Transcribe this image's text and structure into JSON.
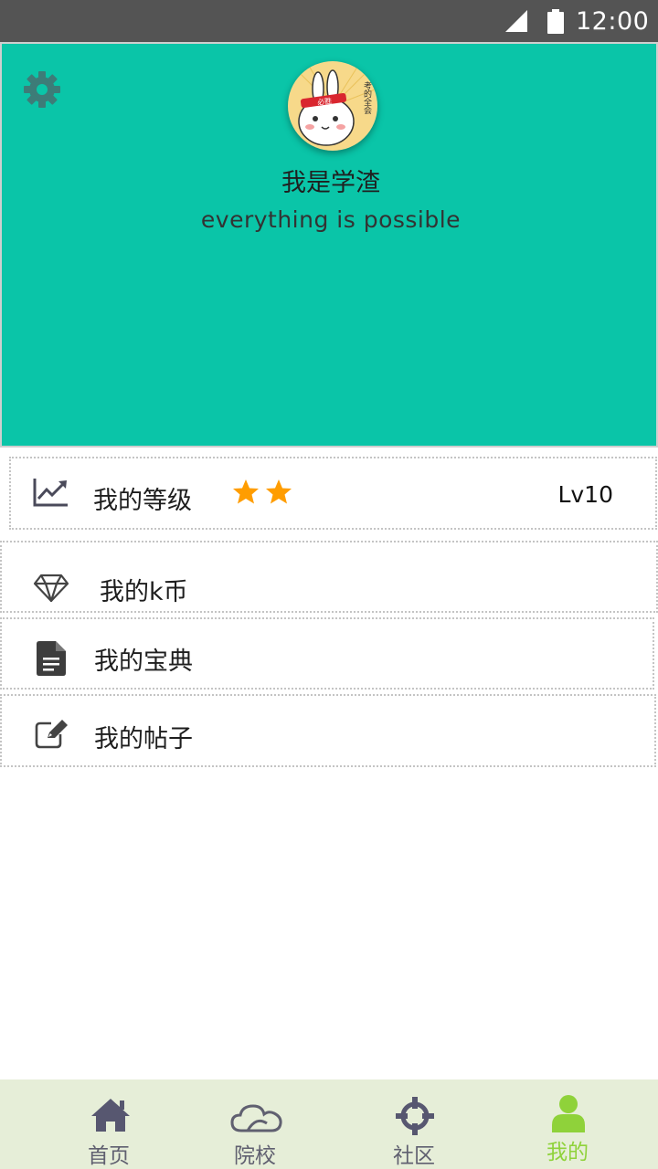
{
  "status_bar": {
    "time": "12:00"
  },
  "profile": {
    "nickname": "我是学渣",
    "motto": "everything is possible",
    "avatar_badge": "必胜",
    "avatar_side_text": "考的全会"
  },
  "menu": {
    "level": {
      "label": "我的等级",
      "stars": 2,
      "value": "Lv10"
    },
    "coin": {
      "label": "我的k币"
    },
    "book": {
      "label": "我的宝典"
    },
    "posts": {
      "label": "我的帖子"
    }
  },
  "bottom_nav": {
    "items": [
      {
        "label": "首页",
        "icon": "home-icon"
      },
      {
        "label": "院校",
        "icon": "cloud-icon"
      },
      {
        "label": "社区",
        "icon": "crosshair-icon"
      },
      {
        "label": "我的",
        "icon": "user-icon"
      }
    ],
    "active_index": 3
  },
  "colors": {
    "header_bg": "#0ac5a8",
    "status_bar_bg": "#545454",
    "star": "#ff9d00",
    "nav_bg": "#e6eed8",
    "nav_active": "#8fd23a",
    "nav_inactive": "#606070"
  }
}
